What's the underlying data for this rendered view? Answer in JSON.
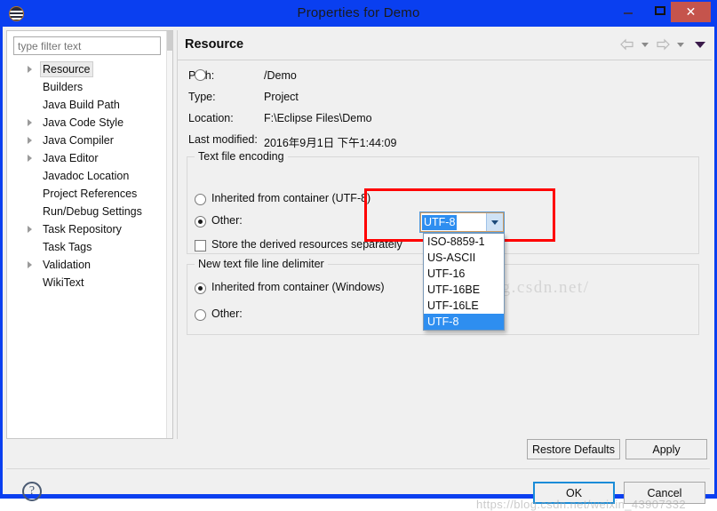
{
  "window": {
    "title": "Properties for Demo",
    "app_icon": "eclipse-icon",
    "minimize_label": "",
    "maximize_label": "",
    "close_label": "✕",
    "titlebar_color": "#0A3FF0",
    "close_button_color": "#C5544C"
  },
  "sidebar": {
    "filter_placeholder": "type filter text",
    "filter_value": "",
    "items": [
      {
        "label": "Resource",
        "expandable": true,
        "selected": true
      },
      {
        "label": "Builders",
        "expandable": false,
        "selected": false
      },
      {
        "label": "Java Build Path",
        "expandable": false,
        "selected": false
      },
      {
        "label": "Java Code Style",
        "expandable": true,
        "selected": false
      },
      {
        "label": "Java Compiler",
        "expandable": true,
        "selected": false
      },
      {
        "label": "Java Editor",
        "expandable": true,
        "selected": false
      },
      {
        "label": "Javadoc Location",
        "expandable": false,
        "selected": false
      },
      {
        "label": "Project References",
        "expandable": false,
        "selected": false
      },
      {
        "label": "Run/Debug Settings",
        "expandable": false,
        "selected": false
      },
      {
        "label": "Task Repository",
        "expandable": true,
        "selected": false
      },
      {
        "label": "Task Tags",
        "expandable": false,
        "selected": false
      },
      {
        "label": "Validation",
        "expandable": true,
        "selected": false
      },
      {
        "label": "WikiText",
        "expandable": false,
        "selected": false
      }
    ]
  },
  "page": {
    "title": "Resource",
    "toolbar": {
      "back_icon": "back-arrow-icon",
      "back_menu_icon": "chevron-down-icon",
      "forward_icon": "forward-arrow-icon",
      "forward_menu_icon": "chevron-down-icon",
      "view_menu_icon": "chevron-down-icon"
    },
    "info": [
      {
        "label": "Path:",
        "value": "/Demo"
      },
      {
        "label": "Type:",
        "value": "Project"
      },
      {
        "label": "Location:",
        "value": "F:\\Eclipse Files\\Demo"
      },
      {
        "label": "Last modified:",
        "value": "2016年9月1日 下午1:44:09"
      }
    ],
    "encoding_group": {
      "legend": "Text file encoding",
      "inherited_label": "Inherited from container (UTF-8)",
      "inherited_selected": false,
      "other_label": "Other:",
      "other_selected": true,
      "combo_value": "UTF-8",
      "dropdown_open": true,
      "dropdown_options": [
        "ISO-8859-1",
        "US-ASCII",
        "UTF-16",
        "UTF-16BE",
        "UTF-16LE",
        "UTF-8"
      ],
      "dropdown_selected": "UTF-8",
      "highlight_color": "#FF0000"
    },
    "store_checkbox": {
      "label": "Store the derived resources separately",
      "checked": false
    },
    "delimiter_group": {
      "legend": "New text file line delimiter",
      "inherited_label": "Inherited from container (Windows)",
      "inherited_selected": true,
      "other_label": "Other:",
      "other_selected": false
    },
    "restore_defaults_label": "Restore Defaults",
    "apply_label": "Apply"
  },
  "footer": {
    "help_icon": "help-question-icon",
    "help_glyph": "?",
    "ok_label": "OK",
    "cancel_label": "Cancel"
  },
  "watermarks": {
    "middle": "http://blog.csdn.net/",
    "bottom": "https://blog.csdn.net/weixin_43907332"
  }
}
